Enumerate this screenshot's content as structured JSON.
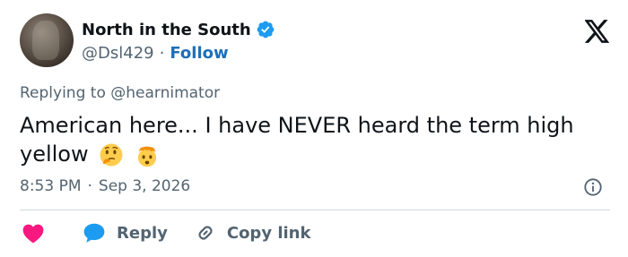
{
  "author": {
    "display_name": "North in the South",
    "handle": "@Dsl429",
    "separator": "·",
    "follow_label": "Follow",
    "verified_color": "#1d9bf0"
  },
  "reply_context": "Replying to @hearnimator",
  "tweet": {
    "text": "American here... I have NEVER heard the term high yellow",
    "emojis": [
      "thinking-face-emoji",
      "exploding-head-emoji"
    ]
  },
  "meta": {
    "time": "8:53 PM",
    "separator": "·",
    "date": "Sep 3, 2026"
  },
  "actions": {
    "reply_label": "Reply",
    "copy_label": "Copy link"
  },
  "colors": {
    "text": "#0f1419",
    "secondary": "#536471",
    "link": "#1d6fb8",
    "heart": "#f91880",
    "reply_bubble": "#1d9bf0",
    "divider": "#cfd9de"
  }
}
